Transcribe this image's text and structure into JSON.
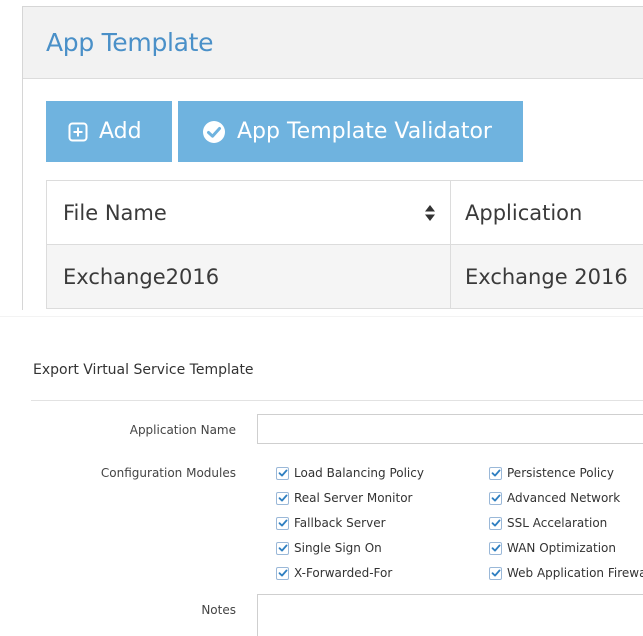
{
  "app_template": {
    "title": "App Template",
    "add_label": "Add",
    "validator_label": "App Template Validator",
    "table": {
      "columns": [
        "File Name",
        "Application"
      ],
      "rows": [
        [
          "Exchange2016",
          "Exchange 2016"
        ]
      ]
    },
    "icons": [
      "plus-square-icon",
      "check-circle-icon",
      "sort-icon"
    ],
    "accent_color": "#6fb3df",
    "title_color": "#4a90c8"
  },
  "export_form": {
    "title": "Export Virtual Service Template",
    "application_name_label": "Application Name",
    "application_name_value": "",
    "configuration_modules_label": "Configuration Modules",
    "notes_label": "Notes",
    "notes_value": "",
    "modules": [
      {
        "label": "Load Balancing Policy",
        "checked": true
      },
      {
        "label": "Persistence Policy",
        "checked": true
      },
      {
        "label": "Real Server Monitor",
        "checked": true
      },
      {
        "label": "Advanced Network",
        "checked": true
      },
      {
        "label": "Fallback Server",
        "checked": true
      },
      {
        "label": "SSL Accelaration",
        "checked": true
      },
      {
        "label": "Single Sign On",
        "checked": true
      },
      {
        "label": "WAN Optimization",
        "checked": true
      },
      {
        "label": "X-Forwarded-For",
        "checked": true
      },
      {
        "label": "Web Application Firewall",
        "checked": true
      }
    ],
    "check_color": "#2f7fc1"
  }
}
